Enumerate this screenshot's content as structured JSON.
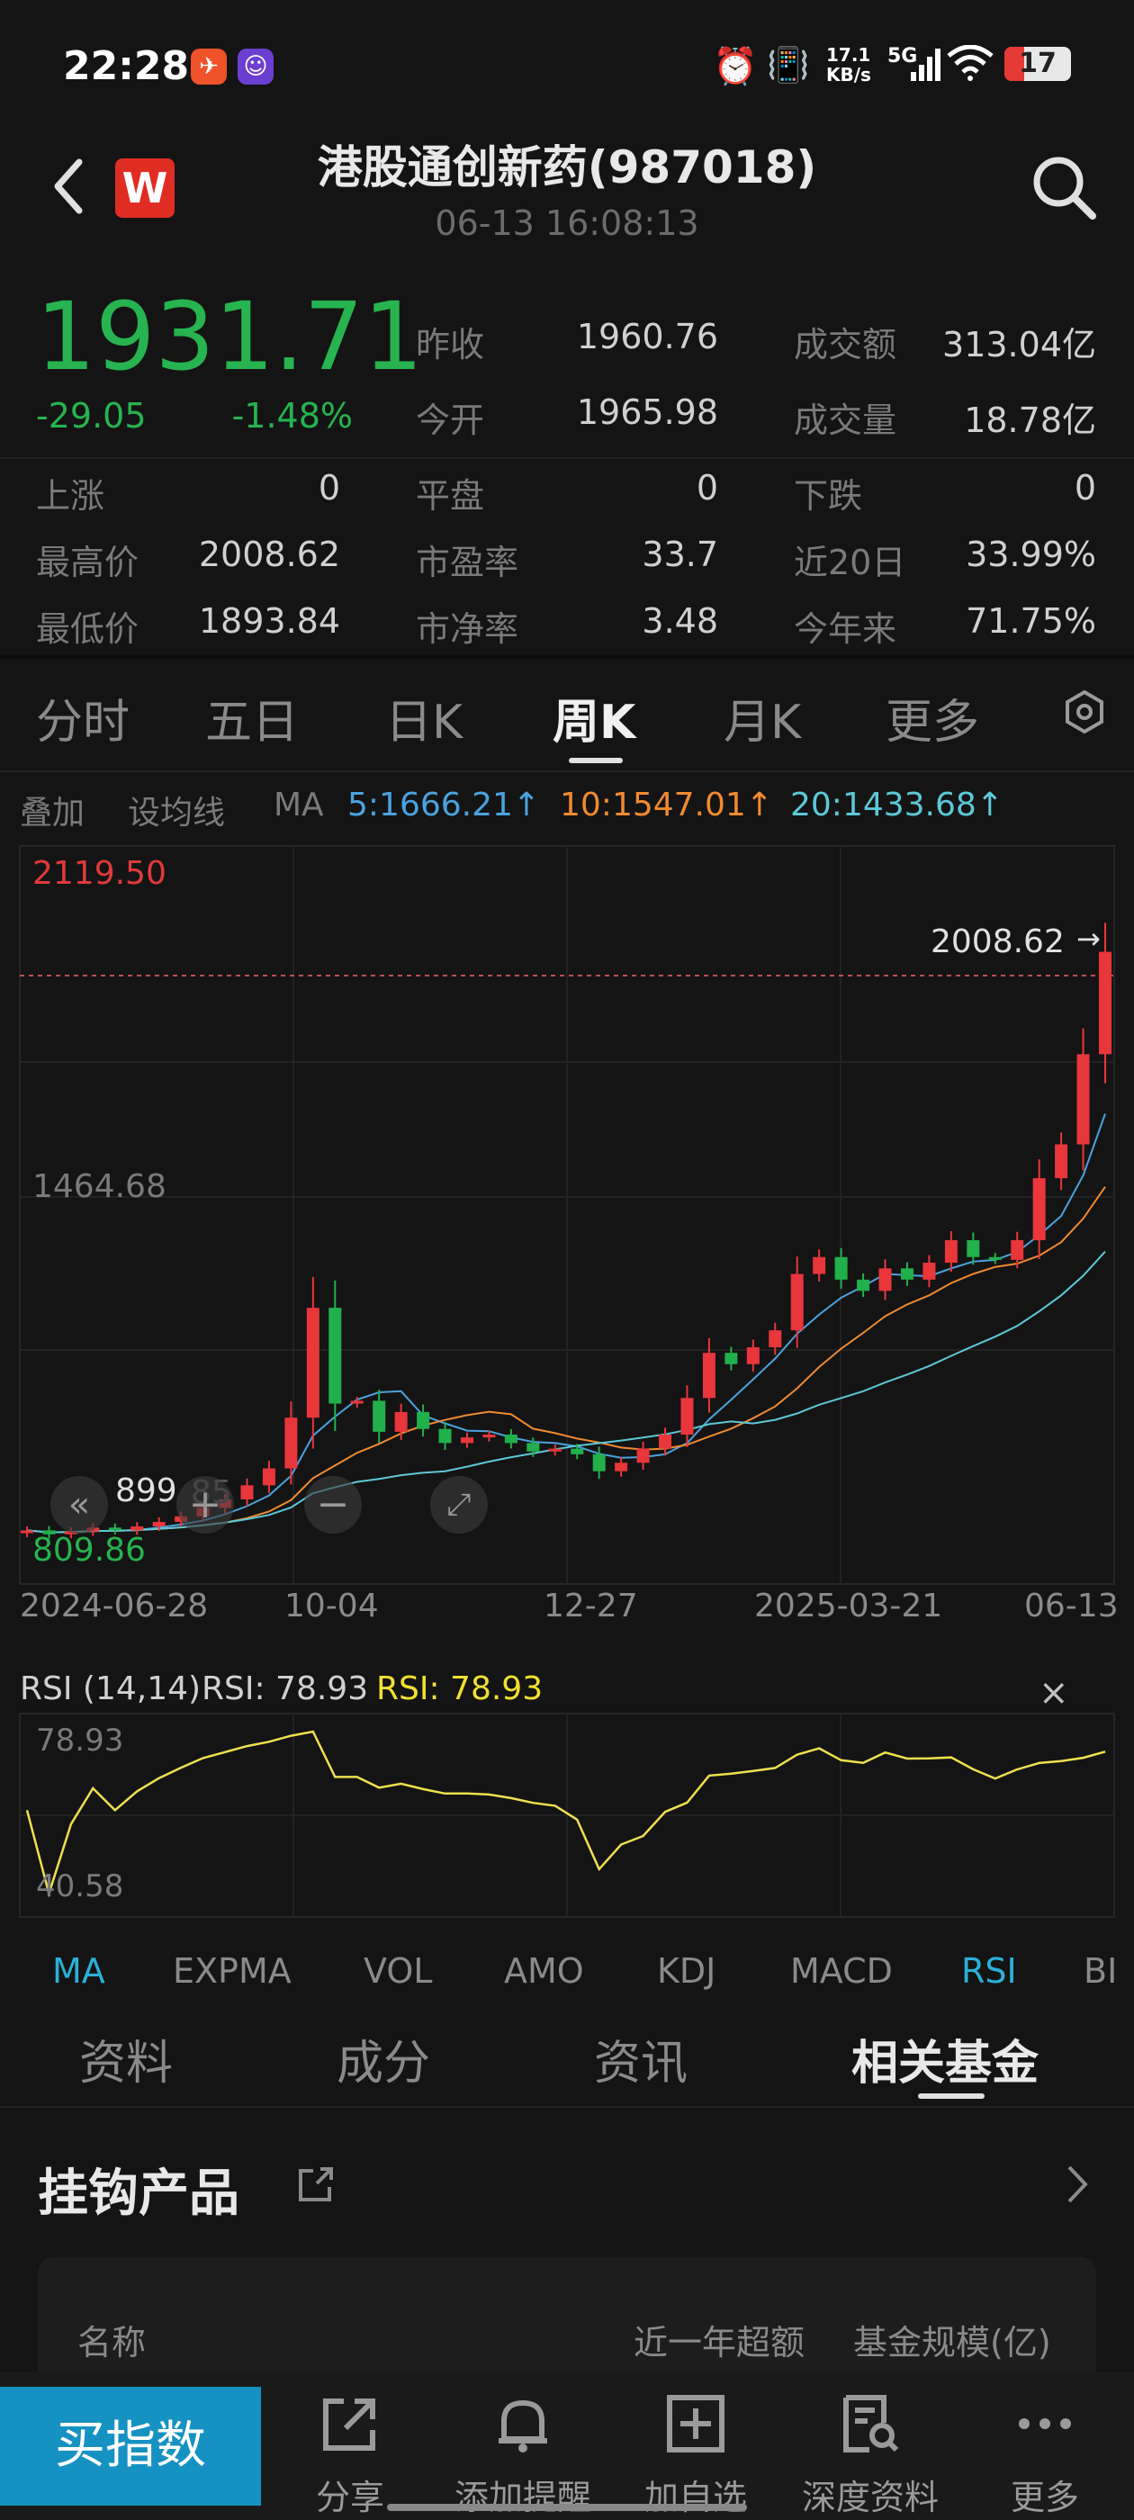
{
  "status_bar": {
    "time": "22:28",
    "network_speed": "17.1\nKB/s",
    "signal": "5G",
    "battery": "17"
  },
  "header": {
    "title": "港股通创新药(987018)",
    "timestamp": "06-13 16:08:13"
  },
  "quote": {
    "price": "1931.71",
    "change": "-29.05",
    "change_pct": "-1.48%",
    "prev_close_label": "昨收",
    "prev_close": "1960.76",
    "open_label": "今开",
    "open": "1965.98",
    "turnover_label": "成交额",
    "turnover": "313.04亿",
    "volume_label": "成交量",
    "volume": "18.78亿",
    "up_label": "上涨",
    "up": "0",
    "flat_label": "平盘",
    "flat": "0",
    "down_label": "下跌",
    "down": "0",
    "high_label": "最高价",
    "high": "2008.62",
    "pe_label": "市盈率",
    "pe": "33.7",
    "d20_label": "近20日",
    "d20": "33.99%",
    "low_label": "最低价",
    "low": "1893.84",
    "pb_label": "市净率",
    "pb": "3.48",
    "ytd_label": "今年来",
    "ytd": "71.75%"
  },
  "chart_tabs": [
    "分时",
    "五日",
    "日K",
    "周K",
    "月K",
    "更多"
  ],
  "ma_bar": {
    "overlay": "叠加",
    "set_ma": "设均线",
    "ma": "MA",
    "ma5": "5:1666.21↑",
    "ma10": "10:1547.01↑",
    "ma20": "20:1433.68↑",
    "ma5_color": "#4aa3df",
    "ma10_color": "#f08a30",
    "ma20_color": "#5cc8d8"
  },
  "kline": {
    "y_top": "2119.50",
    "y_mid": "1464.68",
    "y_bottom": "809.86",
    "max_label": "2008.62",
    "min_label": "899",
    "min_label_tail": "85",
    "x_labels": [
      "2024-06-28",
      "10-04",
      "12-27",
      "2025-03-21",
      "06-13"
    ]
  },
  "rsi": {
    "title": "RSI (14,14)",
    "rsi1": "RSI: 78.93",
    "rsi2": "RSI: 78.93",
    "top": "78.93",
    "bottom": "40.58"
  },
  "indicator_tabs": [
    "MA",
    "EXPMA",
    "VOL",
    "AMO",
    "KDJ",
    "MACD",
    "RSI",
    "BI"
  ],
  "section_tabs": [
    "资料",
    "成分",
    "资讯",
    "相关基金"
  ],
  "linked": {
    "title": "挂钩产品",
    "col_name": "名称",
    "col_excess": "近一年超额",
    "col_size": "基金规模(亿)"
  },
  "bottom_bar": {
    "buy": "买指数",
    "items": [
      "分享",
      "添加提醒",
      "加自选",
      "深度资料",
      "更多"
    ]
  },
  "chart_data": {
    "type": "candlestick",
    "title": "港股通创新药(987018) 周K",
    "ylim": [
      809.86,
      2119.5
    ],
    "x_ticks": [
      "2024-06-28",
      "10-04",
      "12-27",
      "2025-03-21",
      "06-13"
    ],
    "weekly_close_approx": [
      905,
      898,
      903,
      910,
      905,
      912,
      920,
      930,
      945,
      960,
      985,
      1015,
      1105,
      1300,
      1130,
      1135,
      1080,
      1115,
      1085,
      1060,
      1070,
      1075,
      1060,
      1045,
      1050,
      1040,
      1010,
      1025,
      1050,
      1075,
      1140,
      1220,
      1200,
      1230,
      1260,
      1360,
      1390,
      1350,
      1330,
      1370,
      1350,
      1380,
      1420,
      1390,
      1385,
      1420,
      1530,
      1590,
      1750,
      1931.71
    ],
    "ma_values": {
      "MA5": 1666.21,
      "MA10": 1547.01,
      "MA20": 1433.68
    },
    "rsi": {
      "name": "RSI(14,14)",
      "last": 78.93,
      "range": [
        40.58,
        78.93
      ]
    }
  }
}
